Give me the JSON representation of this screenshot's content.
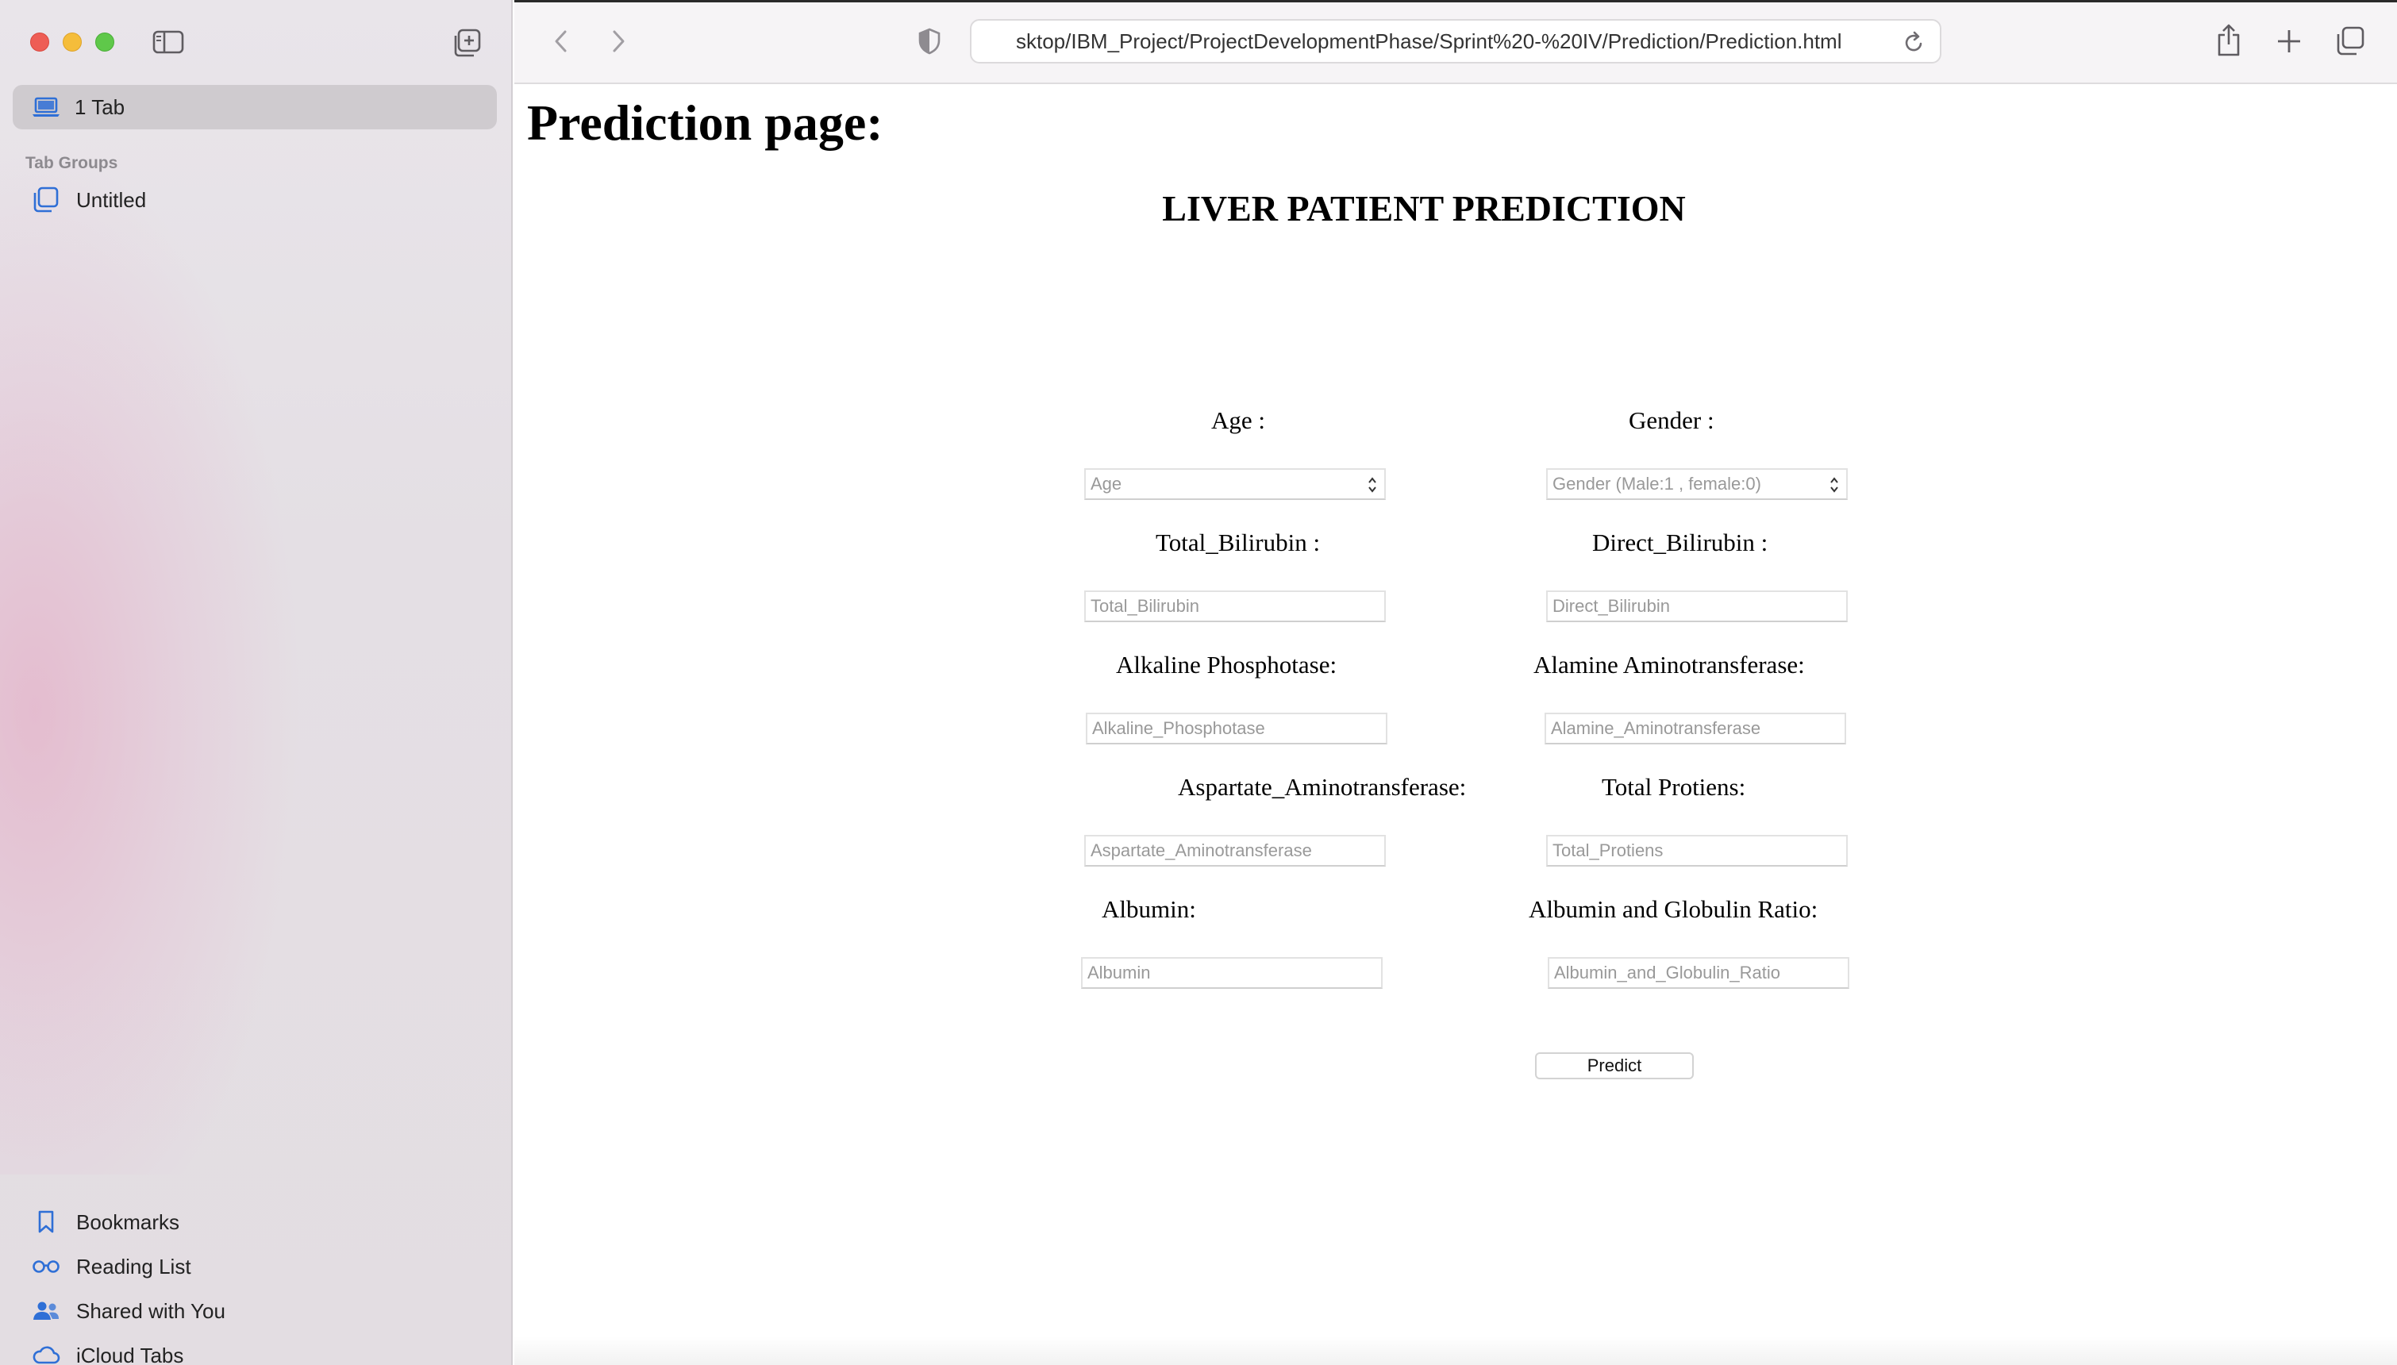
{
  "sidebar": {
    "tab_label": "1 Tab",
    "tab_groups_heading": "Tab Groups",
    "tab_group_item": "Untitled",
    "links": [
      {
        "label": "Bookmarks",
        "icon": "bookmark-icon"
      },
      {
        "label": "Reading List",
        "icon": "glasses-icon"
      },
      {
        "label": "Shared with You",
        "icon": "people-icon"
      },
      {
        "label": "iCloud Tabs",
        "icon": "cloud-icon"
      }
    ]
  },
  "toolbar": {
    "url": "sktop/IBM_Project/ProjectDevelopmentPhase/Sprint%20-%20IV/Prediction/Prediction.html"
  },
  "page": {
    "title": "Prediction page:",
    "heading": "LIVER PATIENT PREDICTION",
    "fields": [
      {
        "label": "Age :",
        "placeholder": "Age",
        "type": "number"
      },
      {
        "label": "Gender :",
        "placeholder": "Gender (Male:1 , female:0)",
        "type": "number"
      },
      {
        "label": "Total_Bilirubin :",
        "placeholder": "Total_Bilirubin",
        "type": "text"
      },
      {
        "label": "Direct_Bilirubin :",
        "placeholder": "Direct_Bilirubin",
        "type": "text"
      },
      {
        "label": "Alkaline Phosphotase:",
        "placeholder": "Alkaline_Phosphotase",
        "type": "text"
      },
      {
        "label": "Alamine Aminotransferase:",
        "placeholder": "Alamine_Aminotransferase",
        "type": "text"
      },
      {
        "label": "Aspartate_Aminotransferase:",
        "placeholder": "Aspartate_Aminotransferase",
        "type": "text"
      },
      {
        "label": "Total Protiens:",
        "placeholder": "Total_Protiens",
        "type": "text"
      },
      {
        "label": "Albumin:",
        "placeholder": "Albumin",
        "type": "text"
      },
      {
        "label": "Albumin and Globulin Ratio:",
        "placeholder": "Albumin_and_Globulin_Ratio",
        "type": "text"
      }
    ],
    "predict_label": "Predict"
  }
}
